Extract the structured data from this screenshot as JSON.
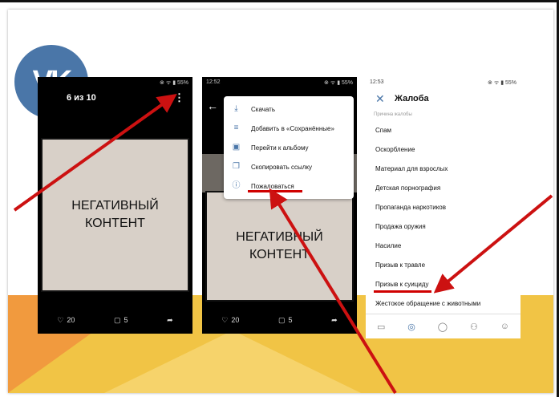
{
  "brand": {
    "logo_text": "VK",
    "logo_color": "#4a76a8"
  },
  "colors": {
    "arrow": "#cc1111",
    "underline": "#d00000",
    "bg_yellow": "#f1c445",
    "bg_orange": "#f19a3e"
  },
  "phone1": {
    "status_left": "",
    "status_right": "⊗ ᯤ ▮ 55%",
    "counter": "6 из 10",
    "menu_icon": "kebab-icon",
    "content_text": "НЕГАТИВНЫЙ\nКОНТЕНТ",
    "likes": "20",
    "comments": "5"
  },
  "phone2": {
    "status_left": "12:52",
    "status_right": "⊗ ᯤ ▮ 55%",
    "menu": [
      {
        "icon": "download-icon",
        "label": "Скачать"
      },
      {
        "icon": "add-to-saved-icon",
        "label": "Добавить в «Сохранённые»"
      },
      {
        "icon": "album-icon",
        "label": "Перейти к альбому"
      },
      {
        "icon": "copy-link-icon",
        "label": "Скопировать ссылку"
      },
      {
        "icon": "report-icon",
        "label": "Пожаловаться"
      }
    ],
    "content_text": "НЕГАТИВНЫЙ\nКОНТЕНТ",
    "likes": "20",
    "comments": "5"
  },
  "phone3": {
    "status_left": "12:53",
    "status_right": "⊗ ᯤ ▮ 55%",
    "title": "Жалоба",
    "section_label": "Причина жалобы",
    "reasons": [
      "Спам",
      "Оскорбление",
      "Материал для взрослых",
      "Детская порнография",
      "Пропаганда наркотиков",
      "Продажа оружия",
      "Насилие",
      "Призыв к травле",
      "Призыв к суициду",
      "Жестокое обращение с животными"
    ]
  }
}
